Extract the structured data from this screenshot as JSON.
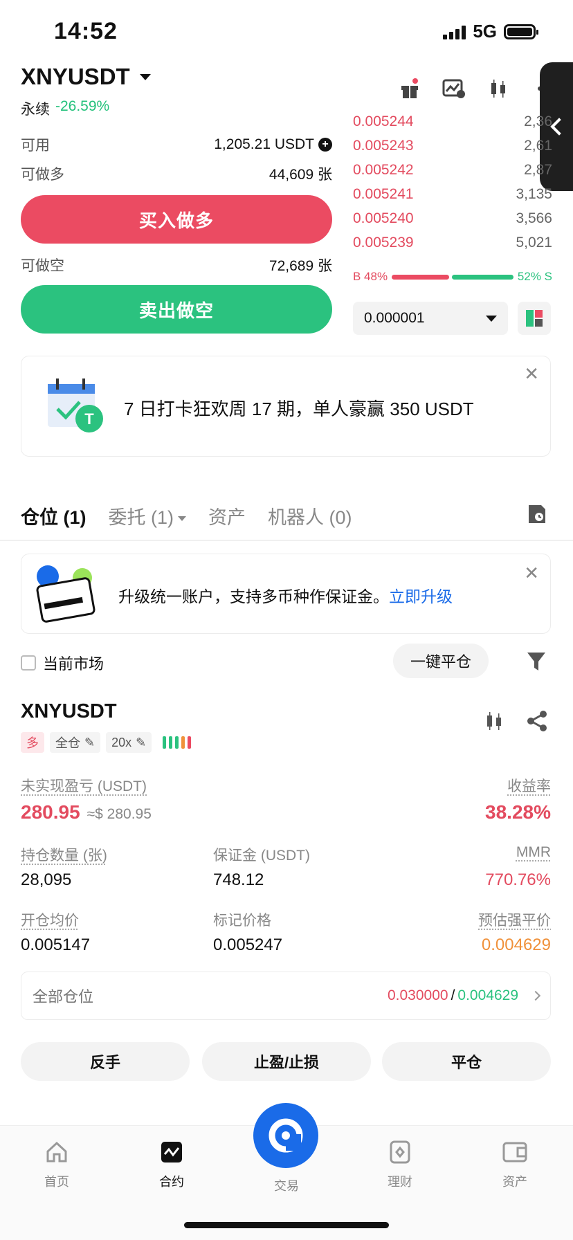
{
  "status": {
    "time": "14:52",
    "network": "5G"
  },
  "header": {
    "pair": "XNYUSDT",
    "type": "永续",
    "change": "-26.59%"
  },
  "trade": {
    "available_label": "可用",
    "available_value": "1,205.21 USDT",
    "can_long_label": "可做多",
    "can_long_value": "44,609 张",
    "buy_label": "买入做多",
    "can_short_label": "可做空",
    "can_short_value": "72,689 张",
    "sell_label": "卖出做空"
  },
  "orderbook": {
    "asks": [
      {
        "price": "0.005244",
        "qty": "2,36"
      },
      {
        "price": "0.005243",
        "qty": "2,61"
      },
      {
        "price": "0.005242",
        "qty": "2,87"
      },
      {
        "price": "0.005241",
        "qty": "3,135"
      },
      {
        "price": "0.005240",
        "qty": "3,566"
      },
      {
        "price": "0.005239",
        "qty": "5,021"
      }
    ],
    "buy_ratio": "B 48%",
    "sell_ratio": "52% S",
    "buy_fraction": 0.48,
    "precision": "0.000001"
  },
  "promo_banner": {
    "text": "7 日打卡狂欢周 17 期，单人豪赢 350 USDT"
  },
  "tabs": [
    {
      "label": "仓位 (1)"
    },
    {
      "label": "委托 (1)"
    },
    {
      "label": "资产"
    },
    {
      "label": "机器人 (0)"
    }
  ],
  "upgrade_banner": {
    "text": "升级统一账户，支持多币种作保证金。",
    "link": "立即升级"
  },
  "filter": {
    "current_market": "当前市场",
    "close_all": "一键平仓"
  },
  "position": {
    "symbol": "XNYUSDT",
    "side_tag": "多",
    "margin_mode": "全仓",
    "leverage": "20x",
    "unrealized_pnl_label": "未实现盈亏 (USDT)",
    "unrealized_pnl": "280.95",
    "unrealized_pnl_usd": "≈$ 280.95",
    "roe_label": "收益率",
    "roe": "38.28%",
    "size_label": "持仓数量 (张)",
    "size": "28,095",
    "margin_label": "保证金 (USDT)",
    "margin": "748.12",
    "mmr_label": "MMR",
    "mmr": "770.76%",
    "entry_label": "开仓均价",
    "entry": "0.005147",
    "mark_label": "标记价格",
    "mark": "0.005247",
    "liq_label": "预估强平价",
    "liq": "0.004629",
    "all_positions_label": "全部仓位",
    "tp_value": "0.030000",
    "separator": "/",
    "sl_value": "0.004629",
    "reverse": "反手",
    "tpsl": "止盈/止损",
    "close": "平仓"
  },
  "nav": {
    "home": "首页",
    "contract": "合约",
    "trade": "交易",
    "finance": "理财",
    "assets": "资产"
  },
  "colors": {
    "red": "#eb4b62",
    "green": "#2bc27f",
    "blue": "#1a6be8",
    "orange": "#f0913a"
  }
}
